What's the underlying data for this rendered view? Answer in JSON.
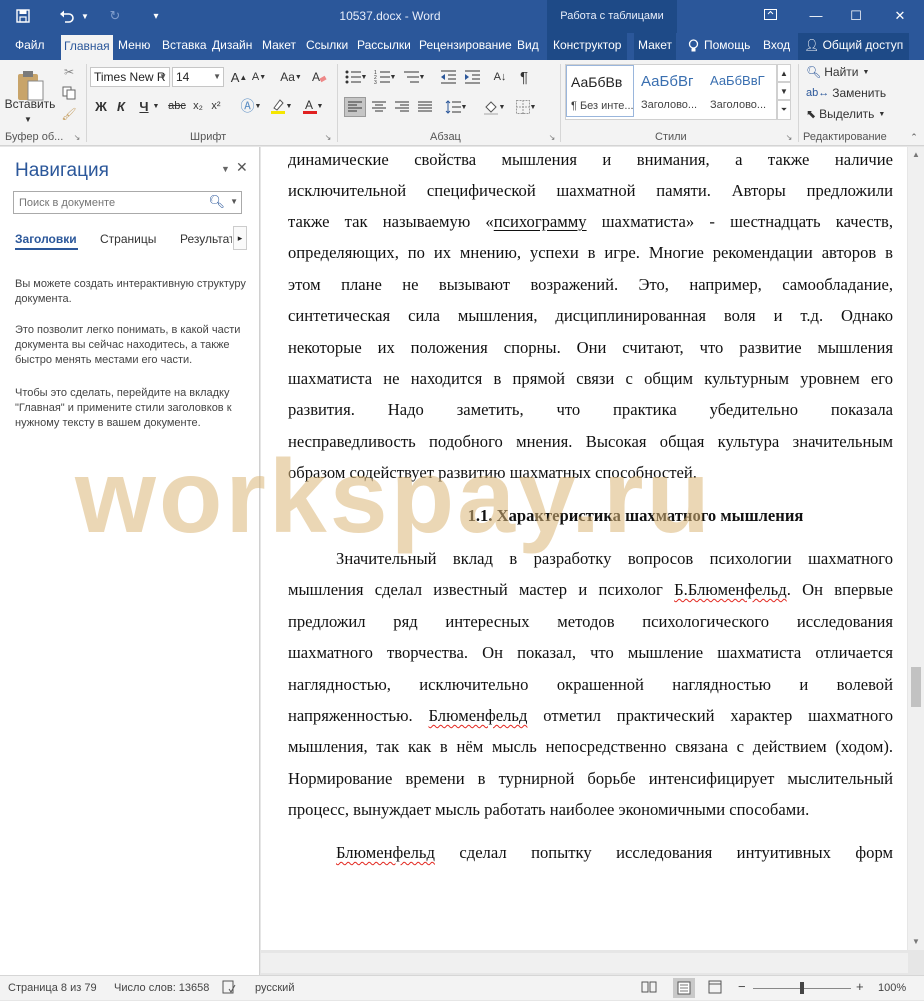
{
  "app": {
    "doc_title": "10537.docx - Word",
    "context_group": "Работа с таблицами"
  },
  "tabs": [
    {
      "label": "Файл",
      "active": false
    },
    {
      "label": "Главная",
      "active": true
    },
    {
      "label": "Меню",
      "active": false
    },
    {
      "label": "Вставка",
      "active": false
    },
    {
      "label": "Дизайн",
      "active": false
    },
    {
      "label": "Макет",
      "active": false
    },
    {
      "label": "Ссылки",
      "active": false
    },
    {
      "label": "Рассылки",
      "active": false
    },
    {
      "label": "Рецензирование",
      "active": false
    },
    {
      "label": "Вид",
      "active": false
    },
    {
      "label": "Конструктор",
      "active": false
    },
    {
      "label": "Макет",
      "active": false
    }
  ],
  "tab_right": {
    "help": "Помощь",
    "signin": "Вход",
    "share": "Общий доступ"
  },
  "ribbon": {
    "clipboard": {
      "paste": "Вставить",
      "group": "Буфер об..."
    },
    "font": {
      "name": "Times New R",
      "size": "14",
      "group": "Шрифт",
      "bold": "Ж",
      "italic": "К",
      "underline": "Ч",
      "strike": "abc",
      "sub": "x₂",
      "sup": "x²",
      "case": "Aa"
    },
    "paragraph": {
      "group": "Абзац"
    },
    "styles": {
      "group": "Стили",
      "items": [
        {
          "sample": "АаБбВв",
          "name": "¶ Без инте..."
        },
        {
          "sample": "АаБбВг",
          "name": "Заголово..."
        },
        {
          "sample": "АаБбВвГ",
          "name": "Заголово..."
        }
      ]
    },
    "editing": {
      "find": "Найти",
      "replace": "Заменить",
      "select": "Выделить",
      "group": "Редактирование"
    }
  },
  "nav": {
    "title": "Навигация",
    "search_placeholder": "Поиск в документе",
    "tabs": [
      "Заголовки",
      "Страницы",
      "Результаты"
    ],
    "para1": "Вы можете создать интерактивную структуру документа.",
    "para2": "Это позволит легко понимать, в какой части документа вы сейчас находитесь, а также быстро менять местами его части.",
    "para3": "Чтобы это сделать, перейдите на вкладку \"Главная\" и примените стили заголовков к нужному тексту в вашем документе."
  },
  "document": {
    "lines": {
      "l01": "динамические свойства мышления и внимания, а также наличие",
      "l02": "исключительной специфической шахматной памяти. Авторы предложили",
      "l03a": "также так называемую «",
      "l03b": "психограмму",
      "l03c": " шахматиста» - шестнадцать качеств,",
      "l04": "определяющих, по их мнению, успехи в игре. Многие рекомендации авторов в",
      "l05": "этом плане не вызывают возражений. Это, например, самообладание,",
      "l06": "синтетическая сила мышления, дисциплинированная воля и т.д. Однако",
      "l07": "некоторые их положения спорны. Они считают, что развитие мышления",
      "l08": "шахматиста не находится в прямой связи с общим культурным уровнем его",
      "l09": "развития. Надо заметить, что практика убедительно показала",
      "l10": "несправедливость подобного мнения. Высокая общая культура значительным",
      "l11": "образом содействует развитию шахматных способностей.",
      "heading": "1.1. Характеристика шахматного мышления",
      "l12": "Значительный вклад в разработку вопросов психологии шахматного",
      "l13a": "мышления сделал известный мастер и психолог ",
      "l13b": "Б.Блюменфельд",
      "l13c": ". Он впервые",
      "l14": "предложил ряд интересных методов психологического исследования",
      "l15": "шахматного творчества. Он показал, что мышление шахматиста отличается",
      "l16": "наглядностью, исключительно окрашенной наглядностью и волевой",
      "l17a": "напряженностью. ",
      "l17b": "Блюменфельд",
      "l17c": " отметил практический характер шахматного",
      "l18": "мышления, так как в нём мысль непосредственно связана с действием (ходом).",
      "l19": "Нормирование времени в турнирной борьбе интенсифицирует мыслительный",
      "l20": "процесс, вынуждает мысль работать наиболее экономичными способами.",
      "l21a": "Блюменфельд",
      "l21b": " сделал попытку исследования интуитивных форм"
    },
    "watermark": "workspay.ru"
  },
  "status": {
    "page": "Страница 8 из 79",
    "words": "Число слов: 13658",
    "language": "русский",
    "zoom": "100%"
  },
  "colors": {
    "brand": "#2b579a",
    "spell_error": "#e2261e",
    "watermark": "#dab678"
  }
}
